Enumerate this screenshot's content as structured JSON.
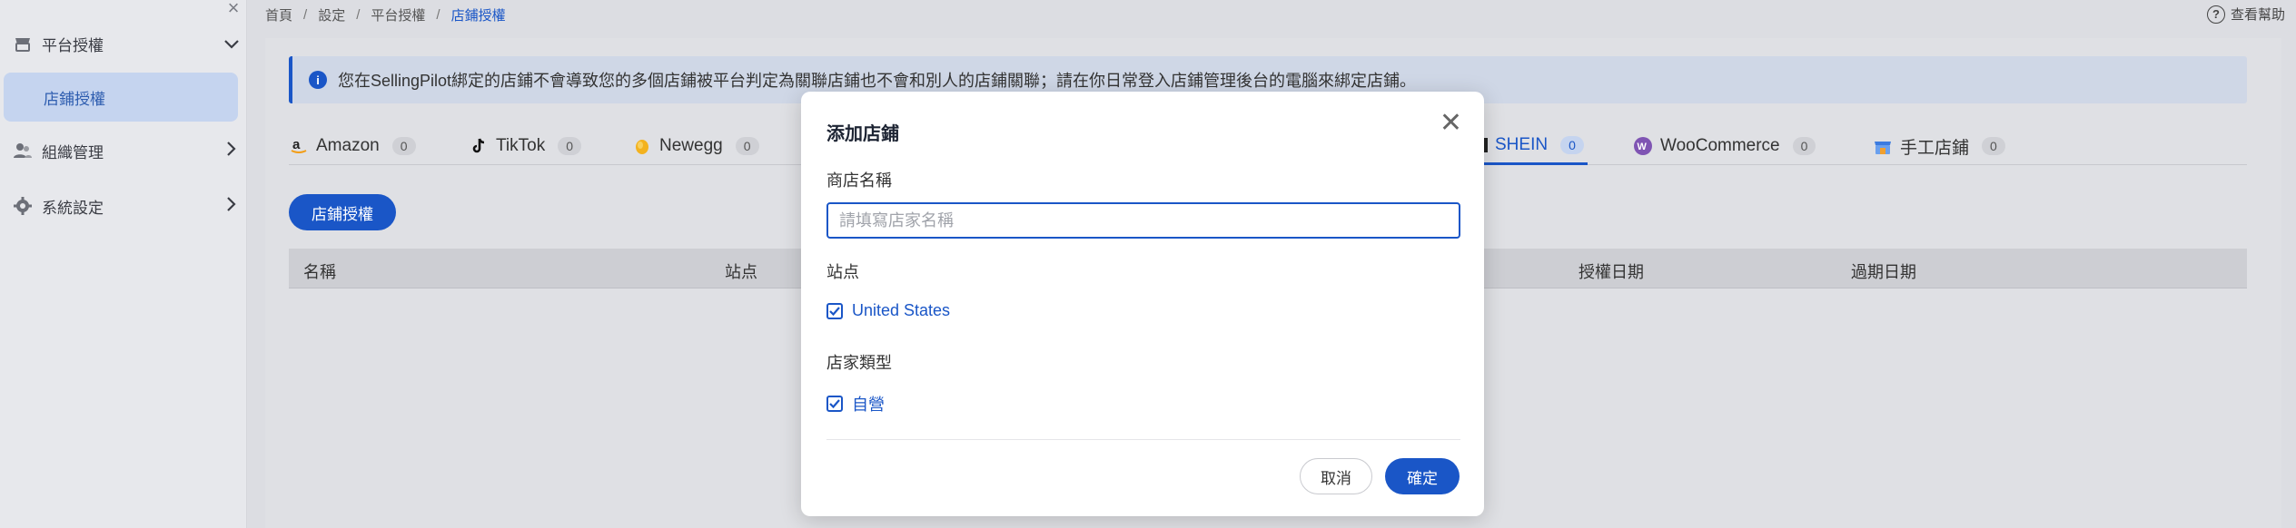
{
  "sidebar": {
    "close_icon": "close-icon",
    "items": [
      {
        "label": "平台授權",
        "icon": "shop-icon",
        "chevron": "chevron-down-icon"
      },
      {
        "label": "店鋪授權"
      },
      {
        "label": "組織管理",
        "icon": "users-icon",
        "chevron": "chevron-right-icon"
      },
      {
        "label": "系統設定",
        "icon": "gear-icon",
        "chevron": "chevron-right-icon"
      }
    ]
  },
  "breadcrumb": {
    "items": [
      "首頁",
      "設定",
      "平台授權",
      "店鋪授權"
    ],
    "separator": "/"
  },
  "help": {
    "label": "查看幫助",
    "icon": "help-icon"
  },
  "notice": {
    "icon": "info-icon",
    "text": "您在SellingPilot綁定的店鋪不會導致您的多個店鋪被平台判定為關聯店鋪也不會和別人的店鋪關聯；請在你日常登入店鋪管理後台的電腦來綁定店鋪。"
  },
  "tabs": [
    {
      "label": "Amazon",
      "count": "0",
      "icon": "amazon-icon"
    },
    {
      "label": "TikTok",
      "count": "0",
      "icon": "tiktok-icon"
    },
    {
      "label": "Newegg",
      "count": "0",
      "icon": "newegg-icon"
    },
    {
      "label": "SHEIN",
      "count": "0",
      "icon": "shein-icon",
      "active": true
    },
    {
      "label": "WooCommerce",
      "count": "0",
      "icon": "woocommerce-icon"
    },
    {
      "label": "手工店鋪",
      "count": "0",
      "icon": "manual-store-icon"
    }
  ],
  "auth_button": "店鋪授權",
  "table": {
    "columns": [
      "名稱",
      "站点",
      "授權日期",
      "過期日期"
    ]
  },
  "modal": {
    "title": "添加店鋪",
    "store_name_label": "商店名稱",
    "store_name_placeholder": "請填寫店家名稱",
    "store_name_value": "",
    "site_label": "站点",
    "site_option": "United States",
    "seller_type_label": "店家類型",
    "seller_type_option": "自營",
    "cancel": "取消",
    "confirm": "確定"
  },
  "colors": {
    "accent": "#1a56c7",
    "sidebar_selected_bg": "#c5d4ef"
  }
}
